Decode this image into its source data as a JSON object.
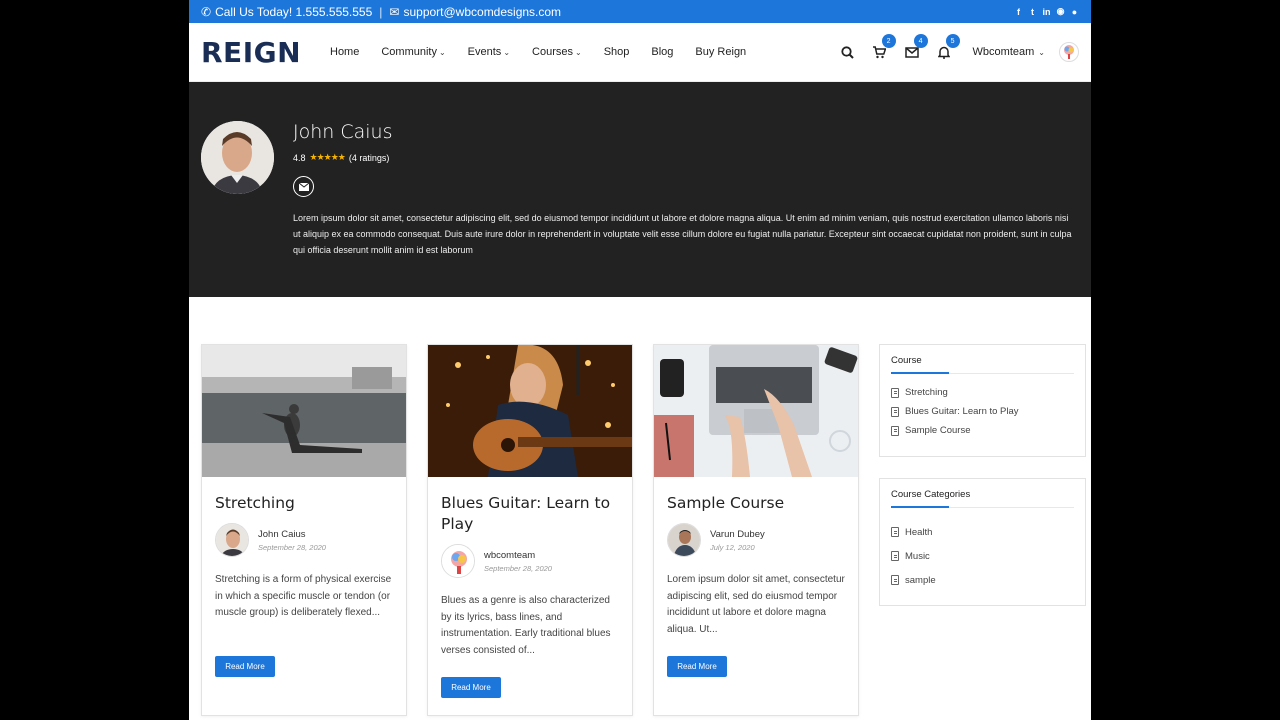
{
  "topbar": {
    "phone": "Call Us Today! 1.555.555.555",
    "email": "support@wbcomdesigns.com",
    "social": [
      "facebook-icon",
      "twitter-icon",
      "linkedin-icon",
      "dribbble-icon",
      "github-icon"
    ]
  },
  "header": {
    "logo": "REIGN",
    "nav": [
      {
        "label": "Home",
        "dropdown": false
      },
      {
        "label": "Community",
        "dropdown": true
      },
      {
        "label": "Events",
        "dropdown": true
      },
      {
        "label": "Courses",
        "dropdown": true
      },
      {
        "label": "Shop",
        "dropdown": false
      },
      {
        "label": "Blog",
        "dropdown": false
      },
      {
        "label": "Buy Reign",
        "dropdown": false
      }
    ],
    "cart_count": "2",
    "messages_count": "4",
    "notifications_count": "5",
    "username": "Wbcomteam"
  },
  "profile": {
    "name": "John Caius",
    "rating": "4.8",
    "stars": "★★★★★",
    "ratings_count": "(4 ratings)",
    "bio": "Lorem ipsum dolor sit amet, consectetur adipiscing elit, sed do eiusmod tempor incididunt ut labore et dolore magna aliqua. Ut enim ad minim veniam, quis nostrud exercitation ullamco laboris nisi ut aliquip ex ea commodo consequat. Duis aute irure dolor in reprehenderit in voluptate velit esse cillum dolore eu fugiat nulla pariatur. Excepteur sint occaecat cupidatat non proident, sunt in culpa qui officia deserunt mollit anim id est laborum"
  },
  "courses": [
    {
      "title": "Stretching",
      "author": "John Caius",
      "date": "September 28, 2020",
      "excerpt": "Stretching is a form of physical exercise in which a specific muscle or tendon (or muscle group) is deliberately flexed...",
      "button": "Read More"
    },
    {
      "title": "Blues Guitar: Learn to Play",
      "author": "wbcomteam",
      "date": "September 28, 2020",
      "excerpt": "Blues as a genre is also characterized by its lyrics, bass lines, and instrumentation. Early traditional blues verses consisted of...",
      "button": "Read More"
    },
    {
      "title": "Sample Course",
      "author": "Varun Dubey",
      "date": "July 12, 2020",
      "excerpt": "Lorem ipsum dolor sit amet, consectetur adipiscing elit, sed do eiusmod tempor incididunt ut labore et dolore magna aliqua. Ut...",
      "button": "Read More"
    }
  ],
  "sidebar": {
    "course_widget": {
      "title": "Course",
      "items": [
        "Stretching",
        "Blues Guitar: Learn to Play",
        "Sample Course"
      ]
    },
    "categories_widget": {
      "title": "Course Categories",
      "items": [
        "Health",
        "Music",
        "sample"
      ]
    }
  },
  "colors": {
    "accent": "#1d76da",
    "hero_bg": "#222222",
    "star": "#f5b301"
  }
}
